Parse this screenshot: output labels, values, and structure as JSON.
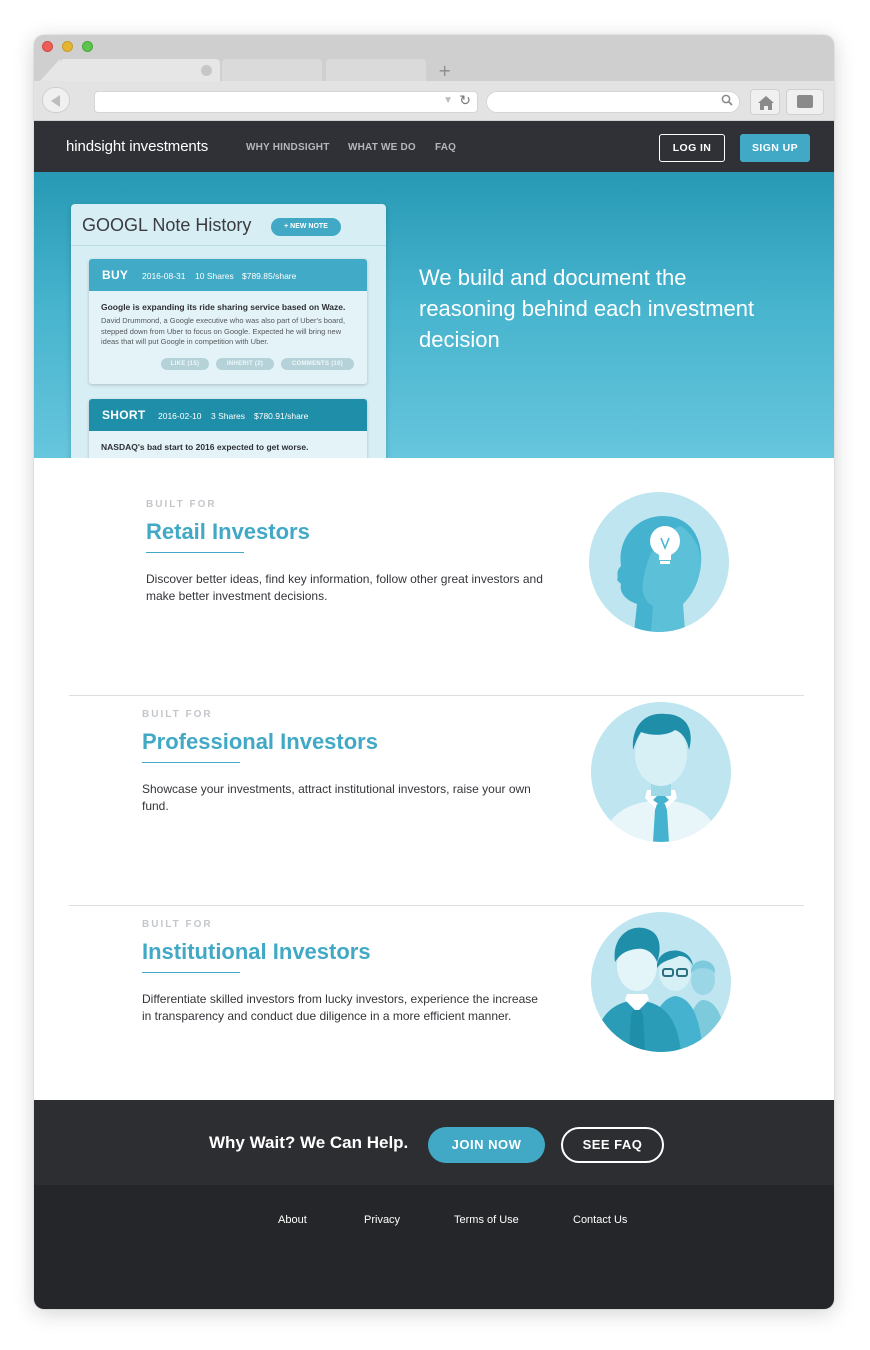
{
  "site": {
    "logo": "hindsight investments",
    "nav": [
      "WHY HINDSIGHT",
      "WHAT WE DO",
      "FAQ"
    ],
    "login_label": "LOG IN",
    "signup_label": "SIGN UP"
  },
  "hero": {
    "tagline": "We build and document the reasoning behind each investment decision",
    "panel": {
      "title": "GOOGL Note History",
      "new_note_label": "+ NEW NOTE",
      "notes": [
        {
          "action": "BUY",
          "date": "2016-08-31",
          "shares": "10 Shares",
          "price": "$789.85/share",
          "headline": "Google is expanding its ride sharing service based on Waze.",
          "body": "David Drummond, a Google executive who was also part of Uber's board, stepped down from Uber to focus on Google. Expected he will bring new ideas that will put Google in competition with Uber.",
          "like": "LIKE (15)",
          "inherit": "INHERIT (2)",
          "comments": "COMMENTS (10)"
        },
        {
          "action": "SHORT",
          "date": "2016-02-10",
          "shares": "3 Shares",
          "price": "$780.91/share",
          "headline": "NASDAQ's bad start to 2016 expected to get worse."
        }
      ]
    }
  },
  "sections": [
    {
      "eyebrow": "BUILT FOR",
      "title": "Retail Investors",
      "text": "Discover better ideas, find key information, follow other great investors and make better investment decisions.",
      "icon": "head-lightbulb-icon"
    },
    {
      "eyebrow": "BUILT FOR",
      "title": "Professional Investors",
      "text": "Showcase your investments, attract institutional investors, raise your own fund.",
      "icon": "businessman-icon"
    },
    {
      "eyebrow": "BUILT FOR",
      "title": "Institutional Investors",
      "text": "Differentiate skilled investors from lucky investors, experience the increase in transparency and conduct due diligence in a more efficient manner.",
      "icon": "group-icon"
    }
  ],
  "cta": {
    "text": "Why Wait? We Can Help.",
    "join_label": "JOIN NOW",
    "faq_label": "SEE FAQ"
  },
  "footer": {
    "links": [
      "About",
      "Privacy",
      "Terms of Use",
      "Contact Us"
    ]
  },
  "colors": {
    "accent": "#41a9c6",
    "nav_bg": "#303136",
    "footer_bg": "#252629"
  }
}
